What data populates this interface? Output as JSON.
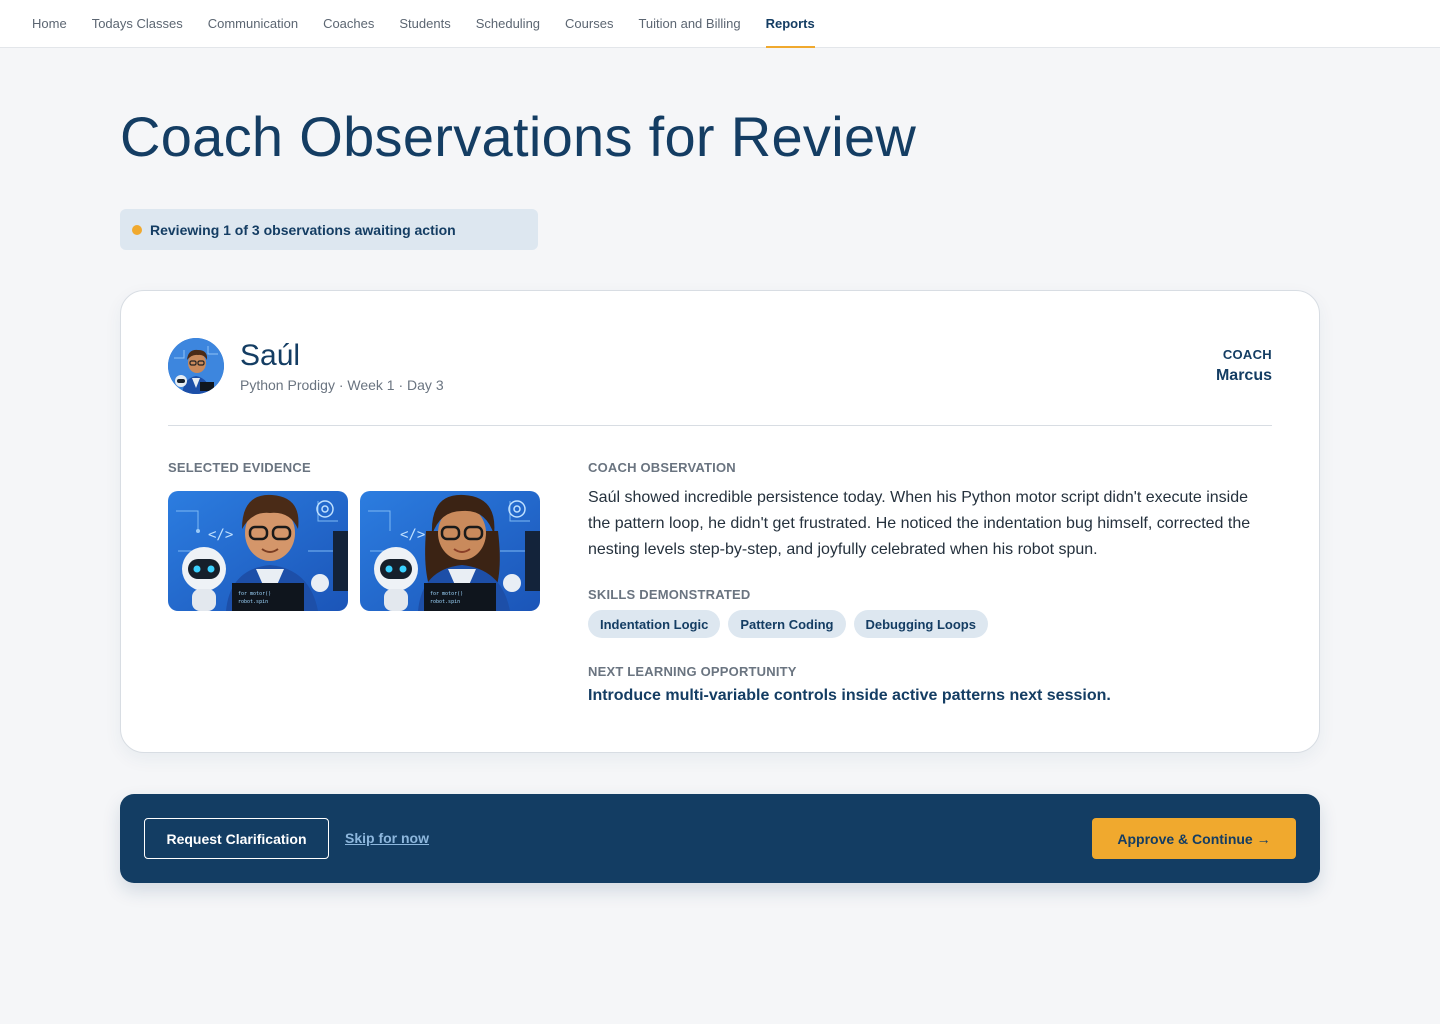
{
  "nav": {
    "items": [
      {
        "label": "Home"
      },
      {
        "label": "Todays Classes"
      },
      {
        "label": "Communication"
      },
      {
        "label": "Coaches"
      },
      {
        "label": "Students"
      },
      {
        "label": "Scheduling"
      },
      {
        "label": "Courses"
      },
      {
        "label": "Tuition and Billing"
      },
      {
        "label": "Reports",
        "active": true
      }
    ]
  },
  "page": {
    "title": "Coach Observations for Review"
  },
  "status": {
    "text": "Reviewing 1 of 3 observations awaiting action"
  },
  "student": {
    "name": "Saúl",
    "meta": "Python Prodigy · Week 1 · Day 3"
  },
  "coach": {
    "label": "COACH",
    "name": "Marcus"
  },
  "evidence": {
    "label": "SELECTED EVIDENCE"
  },
  "observation": {
    "label": "COACH OBSERVATION",
    "text": "Saúl showed incredible persistence today. When his Python motor script didn't execute inside the pattern loop, he didn't get frustrated. He noticed the indentation bug himself, corrected the nesting levels step-by-step, and joyfully celebrated when his robot spun."
  },
  "skills": {
    "label": "SKILLS DEMONSTRATED",
    "items": [
      "Indentation Logic",
      "Pattern Coding",
      "Debugging Loops"
    ]
  },
  "next": {
    "label": "NEXT LEARNING OPPORTUNITY",
    "text": "Introduce multi-variable controls inside active patterns next session."
  },
  "actions": {
    "request_label": "Request Clarification",
    "skip_label": "Skip for now",
    "approve_label": "Approve & Continue →"
  },
  "colors": {
    "navy": "#143d63",
    "accent": "#f0a92e",
    "chip_bg": "#dde7f0",
    "page_bg": "#f5f6f8"
  }
}
